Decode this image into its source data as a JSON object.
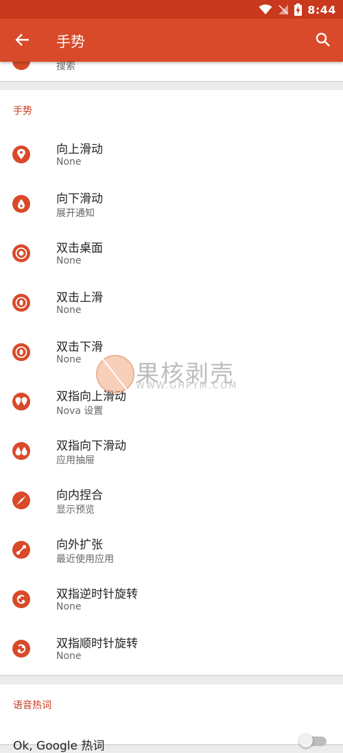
{
  "status_bar": {
    "time": "8:44"
  },
  "app_bar": {
    "title": "手势"
  },
  "top_card": {
    "partial_label": "搜索"
  },
  "gestures": {
    "header": "手势",
    "items": [
      {
        "title": "向上滑动",
        "subtitle": "None",
        "icon": "swipe-up-icon"
      },
      {
        "title": "向下滑动",
        "subtitle": "展开通知",
        "icon": "swipe-down-icon"
      },
      {
        "title": "双击桌面",
        "subtitle": "None",
        "icon": "double-tap-icon"
      },
      {
        "title": "双击上滑",
        "subtitle": "None",
        "icon": "double-tap-swipe-up-icon"
      },
      {
        "title": "双击下滑",
        "subtitle": "None",
        "icon": "double-tap-swipe-down-icon"
      },
      {
        "title": "双指向上滑动",
        "subtitle": "Nova 设置",
        "icon": "two-finger-swipe-up-icon"
      },
      {
        "title": "双指向下滑动",
        "subtitle": "应用抽屉",
        "icon": "two-finger-swipe-down-icon"
      },
      {
        "title": "向内捏合",
        "subtitle": "显示预览",
        "icon": "pinch-in-icon"
      },
      {
        "title": "向外扩张",
        "subtitle": "最近使用应用",
        "icon": "pinch-out-icon"
      },
      {
        "title": "双指逆时针旋转",
        "subtitle": "None",
        "icon": "rotate-ccw-icon"
      },
      {
        "title": "双指顺时针旋转",
        "subtitle": "None",
        "icon": "rotate-cw-icon"
      }
    ]
  },
  "voice": {
    "header": "语音热词",
    "row_title": "Ok, Google 热词",
    "toggle_on": false
  },
  "watermark": {
    "cn": "果核剥壳",
    "en": "WWW.GHPYM.COM"
  },
  "colors": {
    "status_bar": "#c8391d",
    "app_bar": "#d84a29",
    "accent": "#c8391d",
    "background": "#ececec"
  }
}
